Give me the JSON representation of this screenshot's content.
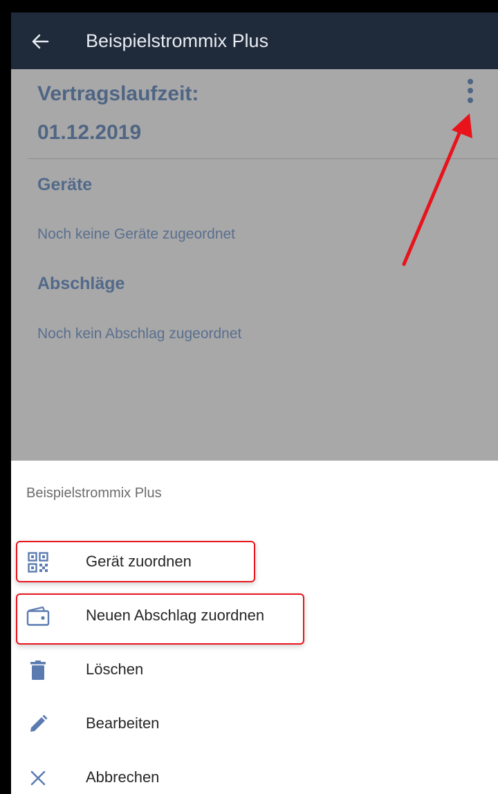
{
  "appbar": {
    "title": "Beispielstrommix Plus",
    "back_icon": "arrow-left-icon"
  },
  "contract": {
    "term_label": "Vertragslaufzeit:",
    "term_value": "01.12.2019",
    "more_icon": "more-vertical-icon"
  },
  "sections": [
    {
      "title": "Geräte",
      "empty_text": "Noch keine Geräte zugeordnet"
    },
    {
      "title": "Abschläge",
      "empty_text": "Noch kein Abschlag zugeordnet"
    }
  ],
  "sheet": {
    "title": "Beispielstrommix Plus",
    "items": [
      {
        "label": "Gerät zuordnen",
        "icon": "qr-code-icon",
        "highlighted": true
      },
      {
        "label": "Neuen Abschlag zuordnen",
        "icon": "wallet-icon",
        "highlighted": true
      },
      {
        "label": "Löschen",
        "icon": "trash-icon",
        "highlighted": false
      },
      {
        "label": "Bearbeiten",
        "icon": "pencil-icon",
        "highlighted": false
      },
      {
        "label": "Abbrechen",
        "icon": "close-icon",
        "highlighted": false
      }
    ]
  },
  "colors": {
    "appbar_bg": "#1f2a3a",
    "overlay_bg": "#a8a8a8",
    "accent_text": "#4f6584",
    "icon_color": "#5b7bb0",
    "annotation_red": "#e8131b"
  }
}
